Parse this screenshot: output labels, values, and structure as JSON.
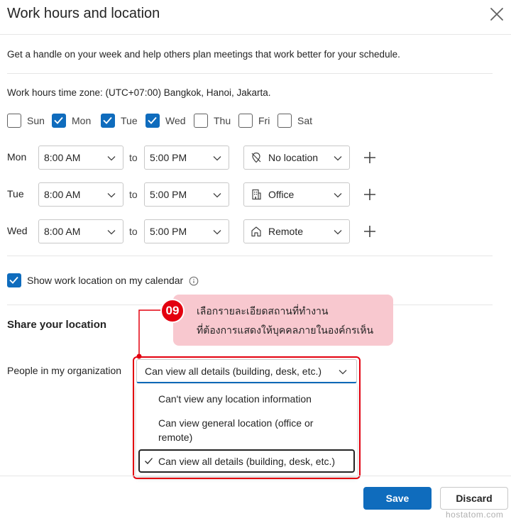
{
  "dialog": {
    "title": "Work hours and location",
    "description": "Get a handle on your week and help others plan meetings that work better for your schedule.",
    "timezone_text": "Work hours time zone: (UTC+07:00) Bangkok, Hanoi, Jakarta."
  },
  "days": [
    {
      "label": "Sun",
      "checked": false
    },
    {
      "label": "Mon",
      "checked": true
    },
    {
      "label": "Tue",
      "checked": true
    },
    {
      "label": "Wed",
      "checked": true
    },
    {
      "label": "Thu",
      "checked": false
    },
    {
      "label": "Fri",
      "checked": false
    },
    {
      "label": "Sat",
      "checked": false
    }
  ],
  "schedule": {
    "to_label": "to",
    "rows": [
      {
        "day": "Mon",
        "start": "8:00 AM",
        "end": "5:00 PM",
        "location": "No location",
        "location_icon": "no-location-icon"
      },
      {
        "day": "Tue",
        "start": "8:00 AM",
        "end": "5:00 PM",
        "location": "Office",
        "location_icon": "office-building-icon"
      },
      {
        "day": "Wed",
        "start": "8:00 AM",
        "end": "5:00 PM",
        "location": "Remote",
        "location_icon": "home-icon"
      }
    ]
  },
  "show_location": {
    "label": "Show work location on my calendar",
    "checked": true
  },
  "share": {
    "title": "Share your location",
    "people_label": "People in my organization",
    "selected_value": "Can view all details (building, desk, etc.)",
    "options": [
      {
        "line1": "Can't view any location information",
        "line2": ""
      },
      {
        "line1": "Can view general location (office or",
        "line2": "remote)"
      },
      {
        "line1": "Can view all details (building, desk, etc.)",
        "line2": "",
        "selected": true
      }
    ]
  },
  "annotation": {
    "step": "09",
    "line1": "เลือกรายละเอียดสถานที่ทำงาน",
    "line2": "ที่ต้องการแสดงให้บุคคลภายในองค์กรเห็น",
    "color": "#e3000f",
    "bubble_color": "#f8c8cf"
  },
  "footer": {
    "save_label": "Save",
    "discard_label": "Discard"
  },
  "watermark": "hostatom.com",
  "colors": {
    "accent": "#0f6cbd"
  }
}
